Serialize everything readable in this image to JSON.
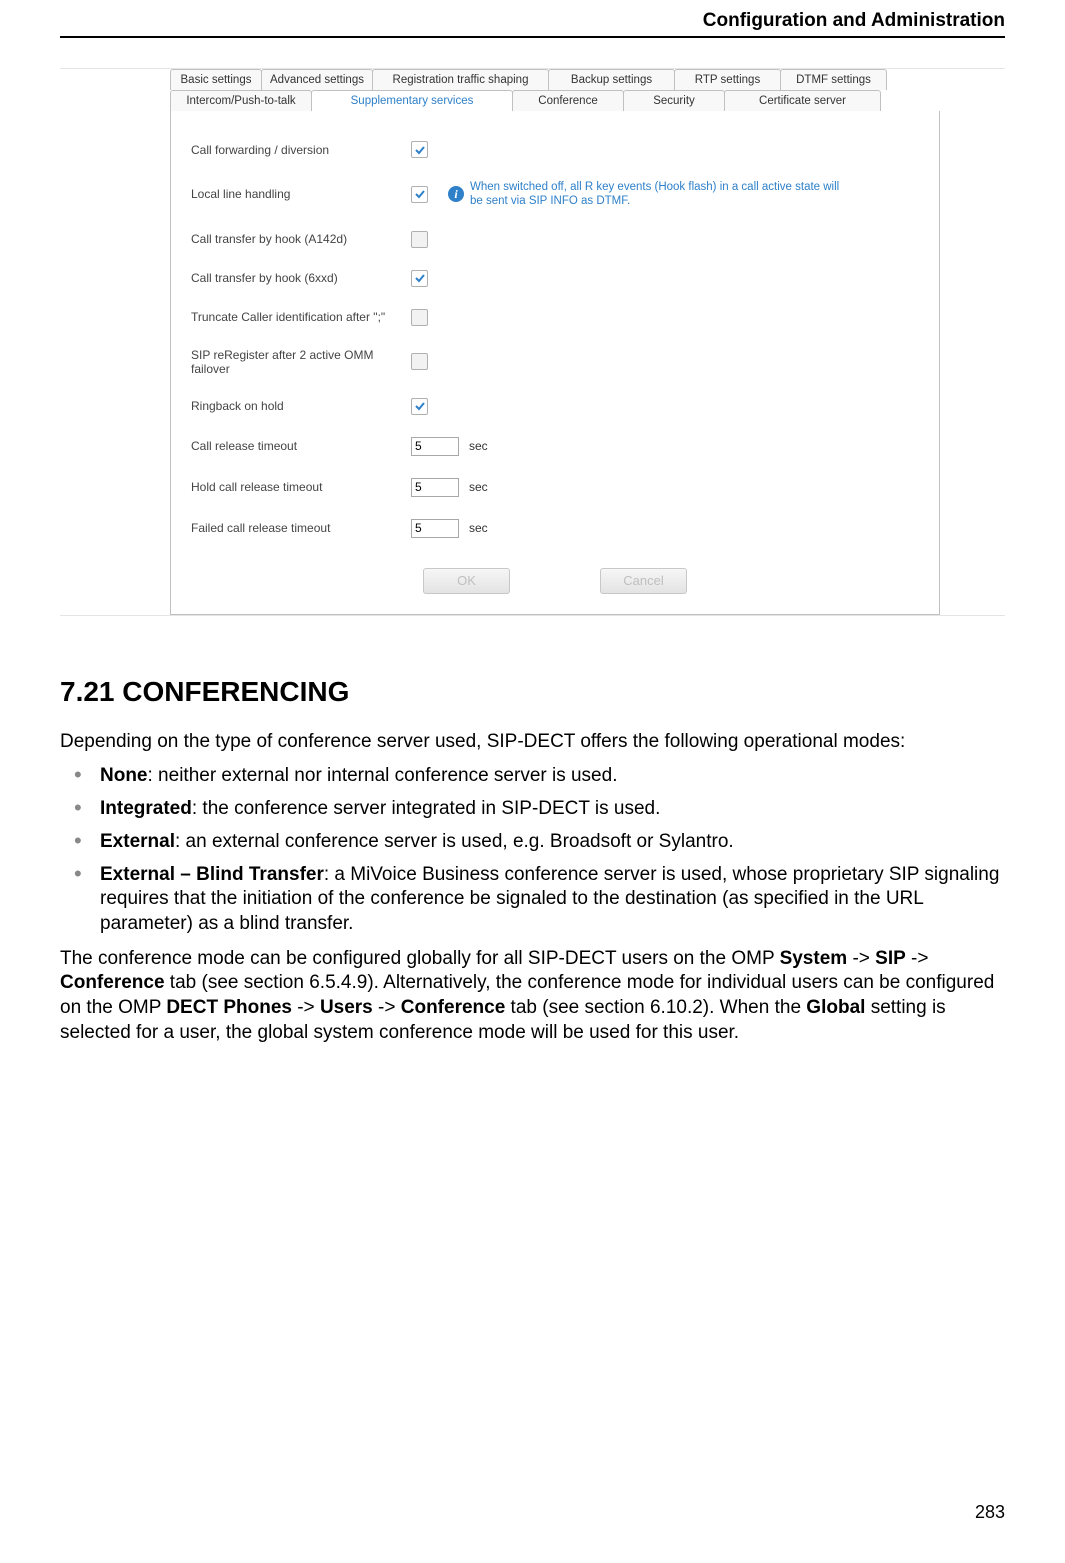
{
  "header": {
    "title": "Configuration and Administration"
  },
  "screenshot": {
    "tabs_row1": [
      "Basic settings",
      "Advanced settings",
      "Registration traffic shaping",
      "Backup settings",
      "RTP settings",
      "DTMF settings"
    ],
    "tabs_row2": [
      "Intercom/Push-to-talk",
      "Supplementary services",
      "Conference",
      "Security",
      "Certificate server"
    ],
    "active_tab": "Supplementary services",
    "rows": {
      "cfwd": {
        "label": "Call forwarding / diversion"
      },
      "lline": {
        "label": "Local line handling",
        "info": "When switched off, all R key events (Hook flash) in a call active state will be sent via SIP INFO as DTMF."
      },
      "cta142": {
        "label": "Call transfer by hook (A142d)"
      },
      "ct6xx": {
        "label": "Call transfer by hook (6xxd)"
      },
      "trunc": {
        "label": "Truncate Caller identification after \";\""
      },
      "rereg": {
        "label": "SIP reRegister after 2 active OMM failover"
      },
      "ringb": {
        "label": "Ringback on hold"
      },
      "crt": {
        "label": "Call release timeout",
        "value": "5",
        "unit": "sec"
      },
      "hcrt": {
        "label": "Hold call release timeout",
        "value": "5",
        "unit": "sec"
      },
      "fcrt": {
        "label": "Failed call release timeout",
        "value": "5",
        "unit": "sec"
      }
    },
    "buttons": {
      "ok": "OK",
      "cancel": "Cancel"
    }
  },
  "section": {
    "heading": "7.21 CONFERENCING",
    "intro": "Depending on the type of conference server used, SIP-DECT offers the following operational modes:",
    "bullets": {
      "none": {
        "term": "None",
        "text": ": neither external nor internal conference server is used."
      },
      "integ": {
        "term": "Integrated",
        "text": ": the conference server integrated in SIP-DECT is used."
      },
      "ext": {
        "term": "External",
        "text": ": an external conference server is used, e.g. Broadsoft or Sylantro."
      },
      "extbt": {
        "term": "External – Blind Transfer",
        "text": ": a MiVoice Business conference server is used, whose proprietary SIP signaling requires that the initiation of the conference be signaled to the destination (as specified in the URL parameter) as a blind transfer."
      }
    },
    "para2": {
      "t1": "The conference mode can be configured globally for all SIP-DECT users on the OMP ",
      "b1": "System",
      "t2": " -> ",
      "b2": "SIP",
      "t3": " -> ",
      "b3": "Conference",
      "t4": " tab (see section 6.5.4.9). Alternatively, the conference mode for individual users can be configured on the OMP ",
      "b4": "DECT Phones",
      "t5": " -> ",
      "b5": "Users",
      "t6": " -> ",
      "b6": "Conference",
      "t7": " tab (see section 6.10.2). When the ",
      "b7": "Global",
      "t8": " setting is selected for a user, the global system conference mode will be used for this user."
    }
  },
  "page_number": "283"
}
